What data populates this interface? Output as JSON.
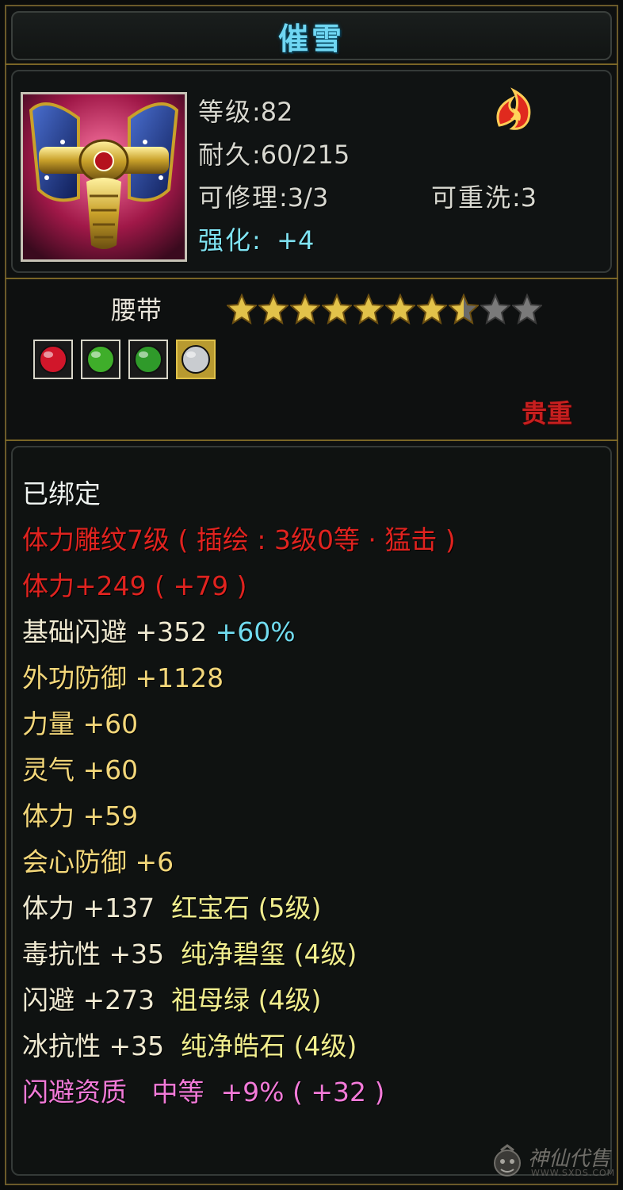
{
  "item": {
    "name": "催雪",
    "type": "腰带",
    "level_label": "等级",
    "level_value": "82",
    "durability_label": "耐久",
    "durability_value": "60/215",
    "repair_label": "可修理",
    "repair_value": "3/3",
    "rewash_label": "可重洗",
    "rewash_value": "3",
    "enhance_label": "强化",
    "enhance_value": "+4",
    "rarity_label": "贵重",
    "stars_filled": 7,
    "stars_half": 1,
    "stars_total": 10
  },
  "gems": [
    {
      "icon": "red-gem-icon",
      "color": "#d1162a"
    },
    {
      "icon": "green-gem-icon",
      "color": "#3fae2a"
    },
    {
      "icon": "green-gem-icon",
      "color": "#2f9a2a"
    },
    {
      "icon": "silver-gem-icon",
      "color": "#c9ccd0"
    }
  ],
  "attributes": {
    "bound": "已绑定",
    "engraving": "体力雕纹7级 ( 插绘 : 3级0等 · 猛击 )",
    "vitality_engrave": "体力+249 ( +79 )",
    "dodge_base_label": "基础闪避",
    "dodge_base_value": "+352",
    "dodge_base_pct": "+60%",
    "outer_def_label": "外功防御",
    "outer_def_value": "+1128",
    "strength_label": "力量",
    "strength_value": "+60",
    "spirit_label": "灵气",
    "spirit_value": "+60",
    "vitality_label": "体力",
    "vitality_value": "+59",
    "crit_def_label": "会心防御",
    "crit_def_value": "+6",
    "gem1_label": "体力",
    "gem1_value": "+137",
    "gem1_name": "红宝石 (5级)",
    "gem2_label": "毒抗性",
    "gem2_value": "+35",
    "gem2_name": "纯净碧玺 (4级)",
    "gem3_label": "闪避",
    "gem3_value": "+273",
    "gem3_name": "祖母绿 (4级)",
    "gem4_label": "冰抗性",
    "gem4_value": "+35",
    "gem4_name": "纯净皓石 (4级)",
    "aptitude_label": "闪避资质",
    "aptitude_grade": "中等",
    "aptitude_value": "+9% ( +32 )"
  },
  "watermark": {
    "text": "神仙代售",
    "url": "WWW.SXDS.COM"
  },
  "colors": {
    "title": "#6fd6f2",
    "gold_border": "#7a6526",
    "red": "#e0231f",
    "pink": "#f27ad8",
    "cyan": "#71dcf0"
  }
}
